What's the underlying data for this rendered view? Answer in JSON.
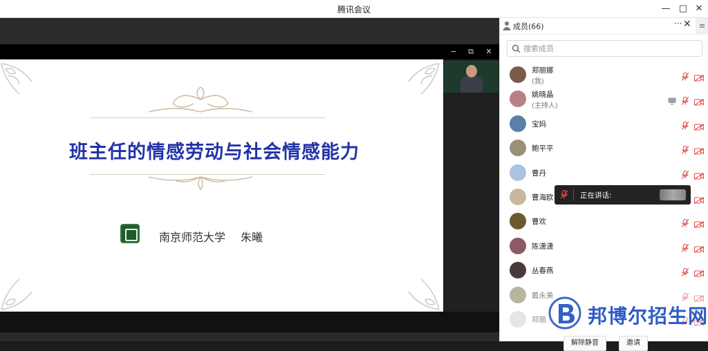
{
  "window": {
    "title": "腾讯会议",
    "controls": [
      "—",
      "□",
      "✕"
    ]
  },
  "share": {
    "controls": [
      "−",
      "⧉",
      "✕"
    ]
  },
  "slide": {
    "title": "班主任的情感劳动与社会情感能力",
    "university": "南京师范大学",
    "author": "朱曦"
  },
  "panel": {
    "title": "成员(66)",
    "more": "···",
    "close": "✕",
    "side": "≡",
    "search_placeholder": "搜索成员",
    "members": [
      {
        "name": "郑丽娜",
        "role": "(我)",
        "avatar_color": "#7a5a4a"
      },
      {
        "name": "姚晓晶",
        "role": "(主持人)",
        "avatar_color": "#b97f86",
        "sharing": true
      },
      {
        "name": "宝妈",
        "role": "",
        "avatar_color": "#5b7fa6"
      },
      {
        "name": "鲍平平",
        "role": "",
        "avatar_color": "#9a8f78"
      },
      {
        "name": "曹丹",
        "role": "",
        "avatar_color": "#a9c3e0"
      },
      {
        "name": "曹海欧",
        "role": "",
        "avatar_color": "#c8b8a0"
      },
      {
        "name": "曹欢",
        "role": "",
        "avatar_color": "#6b5a30"
      },
      {
        "name": "陈潇潇",
        "role": "",
        "avatar_color": "#8a5a66"
      },
      {
        "name": "丛春燕",
        "role": "",
        "avatar_color": "#4a3a3a"
      },
      {
        "name": "戴永美",
        "role": "",
        "avatar_color": "#7a7a50"
      },
      {
        "name": "邓丽",
        "role": "",
        "avatar_color": "#cfcfcf"
      }
    ],
    "buttons": [
      "解除静音",
      "邀请"
    ]
  },
  "toast": {
    "text": "正在讲话:"
  },
  "watermark": {
    "text": "邦博尔招生网"
  },
  "colors": {
    "slide_title": "#2233a8",
    "muted_red": "#e05050",
    "video_red": "#e05050",
    "watermark_blue": "#1e4fbf"
  }
}
